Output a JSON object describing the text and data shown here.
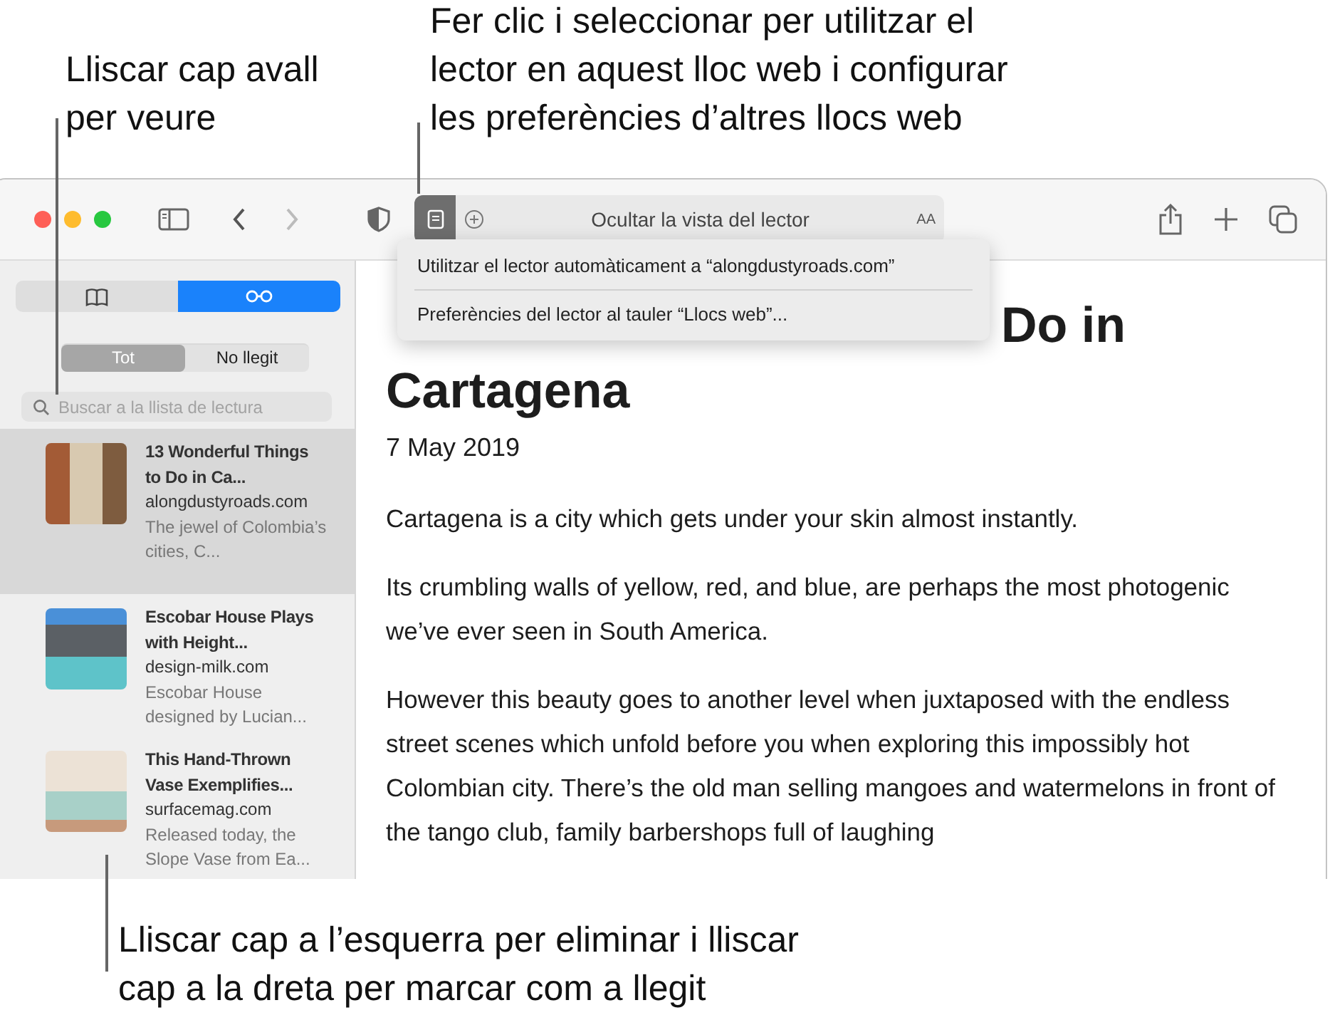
{
  "callouts": [
    {
      "kind": "scroll",
      "text": "Lliscar cap avall\nper veure"
    },
    {
      "kind": "reader",
      "text": "Fer clic i seleccionar per utilitzar el\nlector en aquest lloc web i configurar\nles preferències d’altres llocs web"
    },
    {
      "kind": "swipe",
      "text": "Lliscar cap a l’esquerra per eliminar i lliscar\ncap a la dreta per marcar com a llegit"
    }
  ],
  "address_bar": {
    "reader_on": true,
    "text": "Ocultar la vista del lector",
    "text_size": "AA"
  },
  "reader_menu": {
    "items": [
      "Utilitzar el lector automàticament a “alongdustyroads.com”",
      "Preferències del lector al tauler “Llocs web”..."
    ]
  },
  "sidebar": {
    "tabs": [
      {
        "kind": "bookmarks",
        "selected": false
      },
      {
        "kind": "reading-list",
        "selected": true
      }
    ],
    "filters": [
      {
        "label": "Tot",
        "selected": true
      },
      {
        "label": "No llegit",
        "selected": false
      }
    ],
    "search": {
      "placeholder": "Buscar a la llista de lectura"
    },
    "items": [
      {
        "title": "13 Wonderful Things to Do in Ca...",
        "site": "alongdustyroads.com",
        "summary": "The jewel of Colombia’s cities, C...",
        "kind": "street",
        "selected": true
      },
      {
        "title": "Escobar House Plays with Height...",
        "site": "design-milk.com",
        "summary": "Escobar House designed by Lucian...",
        "kind": "house",
        "selected": false
      },
      {
        "title": "This Hand-Thrown Vase Exemplifies...",
        "site": "surfacemag.com",
        "summary": "Released today, the Slope Vase from Ea...",
        "kind": "vase",
        "selected": false
      }
    ]
  },
  "article": {
    "title_lines": [
      "Do in",
      "Cartagena"
    ],
    "date": "7 May 2019",
    "paragraphs": [
      "Cartagena is a city which gets under your skin almost instantly.",
      "Its crumbling walls of yellow, red, and blue, are perhaps the most photogenic we’ve ever seen in South America.",
      "However this beauty goes to another level when juxtaposed with the endless street scenes which unfold before you when exploring this impossibly hot Colombian city. There’s the old man selling mangoes and watermelons in front of the tango club, family barbershops full of laughing"
    ]
  }
}
